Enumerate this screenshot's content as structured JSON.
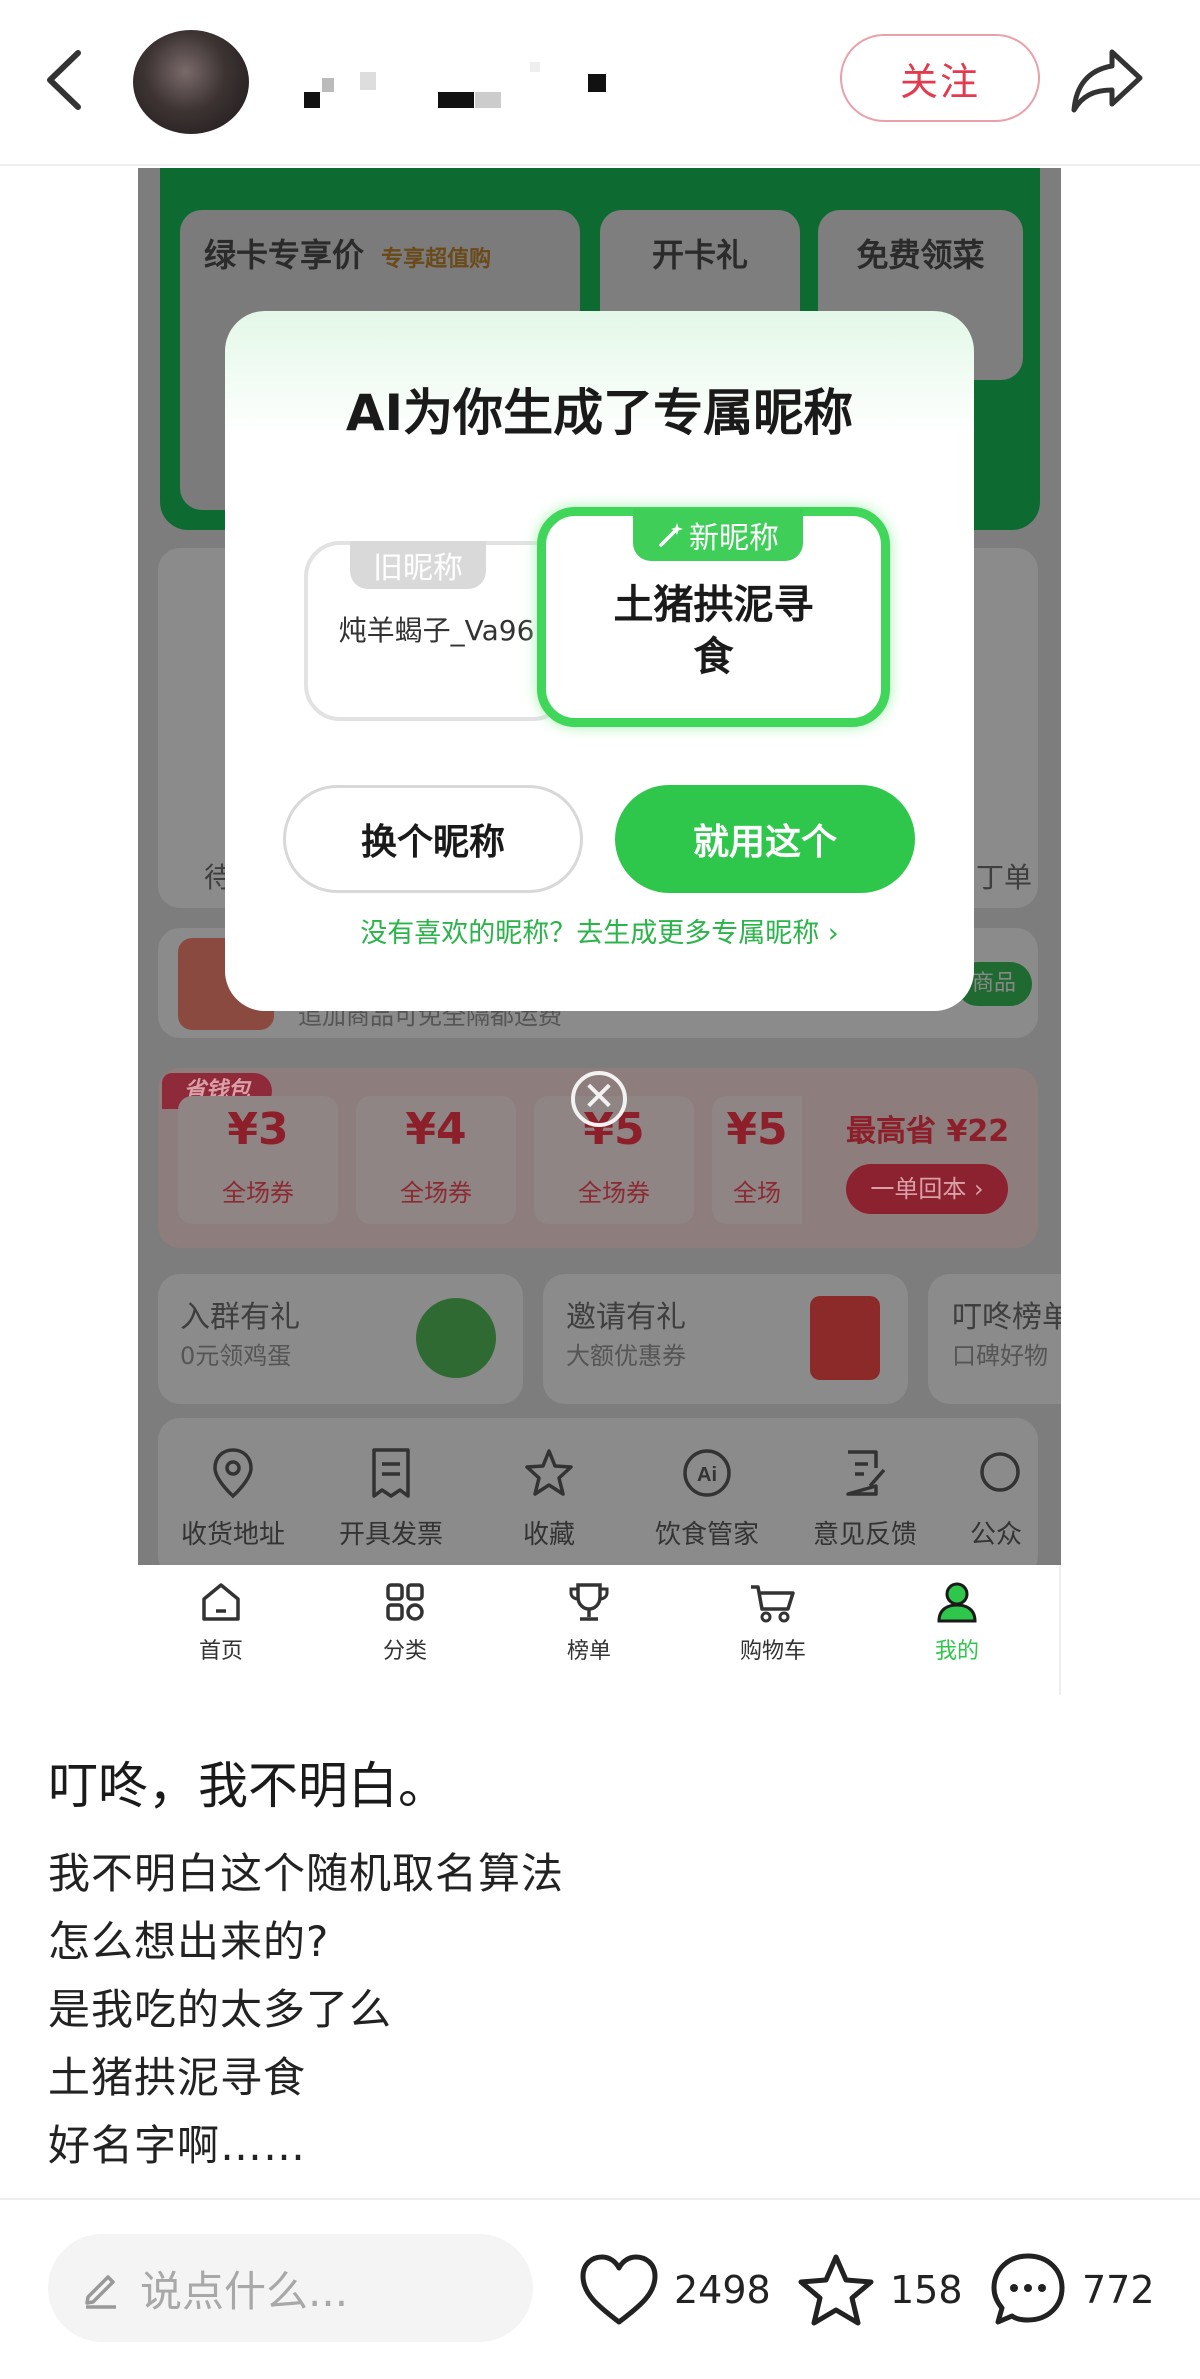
{
  "header": {
    "follow_label": "关注"
  },
  "app": {
    "top_cards": [
      "绿卡专享价",
      "专享超值购",
      "开卡礼",
      "免费领菜"
    ],
    "side_labels": [
      "待",
      "丁单"
    ],
    "product_badge": "商品",
    "product_sub": "追加商品可免全隔都运费",
    "coupon_tag": "省钱包",
    "coupons": [
      {
        "amount": "¥3",
        "label": "全场券"
      },
      {
        "amount": "¥4",
        "label": "全场券"
      },
      {
        "amount": "¥5",
        "label": "全场券"
      },
      {
        "amount": "¥5",
        "label": "全场"
      }
    ],
    "max_save": "最高省 ¥22",
    "payback_btn": "一单回本 ›",
    "promos": [
      {
        "title": "入群有礼",
        "sub": "0元领鸡蛋"
      },
      {
        "title": "邀请有礼",
        "sub": "大额优惠券"
      },
      {
        "title": "叮咚榜单",
        "sub": "口碑好物"
      }
    ],
    "tools": [
      "收货地址",
      "开具发票",
      "收藏",
      "饮食管家",
      "意见反馈",
      "公众"
    ],
    "tabs": [
      {
        "label": "首页",
        "icon": "home-icon"
      },
      {
        "label": "分类",
        "icon": "category-icon"
      },
      {
        "label": "榜单",
        "icon": "trophy-icon"
      },
      {
        "label": "购物车",
        "icon": "cart-icon"
      },
      {
        "label": "我的",
        "icon": "profile-icon"
      }
    ],
    "active_tab_color": "#2fc64c"
  },
  "dialog": {
    "title": "AI为你生成了专属昵称",
    "old_tag": "旧昵称",
    "old_name": "炖羊蝎子_Va96",
    "new_tag": "新昵称",
    "new_name": "土猪拱泥寻食",
    "change_btn": "换个昵称",
    "use_btn": "就用这个",
    "more_link": "没有喜欢的昵称？去生成更多专属昵称 ›"
  },
  "post": {
    "title": "叮咚，我不明白。",
    "lines": [
      "我不明白这个随机取名算法",
      "怎么想出来的?",
      "是我吃的太多了么",
      "土猪拱泥寻食",
      "好名字啊……"
    ]
  },
  "bottom": {
    "comment_placeholder": "说点什么...",
    "likes": "2498",
    "stars": "158",
    "comments": "772"
  }
}
